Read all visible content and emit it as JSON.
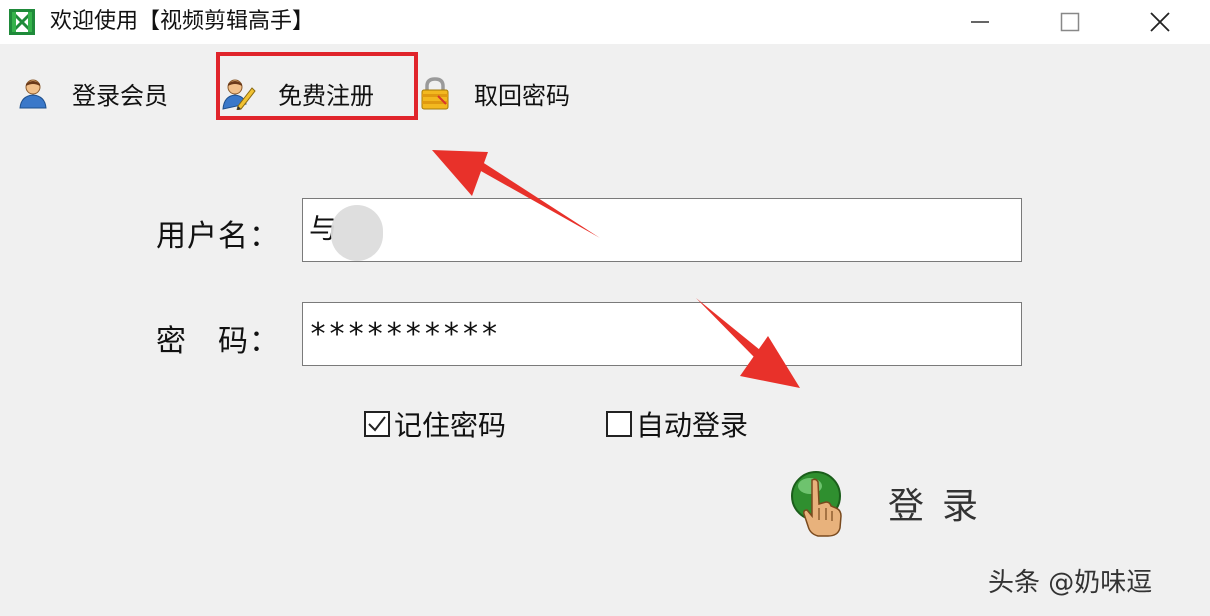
{
  "window": {
    "title": "欢迎使用【视频剪辑高手】",
    "icons": [
      "app-icon",
      "minimize-icon",
      "maximize-icon",
      "close-icon"
    ]
  },
  "toolbar": {
    "items": [
      {
        "label": "登录会员",
        "icon": "member-user-icon"
      },
      {
        "label": "免费注册",
        "icon": "register-pencil-icon"
      },
      {
        "label": "取回密码",
        "icon": "padlock-icon"
      }
    ],
    "highlight_color": "#e0242b"
  },
  "form": {
    "username_label": "用户名：",
    "username_value": "与",
    "password_label": "密　码：",
    "password_value": "**********",
    "remember_password": {
      "label": "记住密码",
      "checked": true
    },
    "auto_login": {
      "label": "自动登录",
      "checked": false
    }
  },
  "login_button": {
    "label": "登录",
    "icon": "hand-pointer-icon"
  },
  "annotations": {
    "arrow_color": "#e8312a",
    "count": 2
  },
  "watermark": "头条 @奶味逗"
}
